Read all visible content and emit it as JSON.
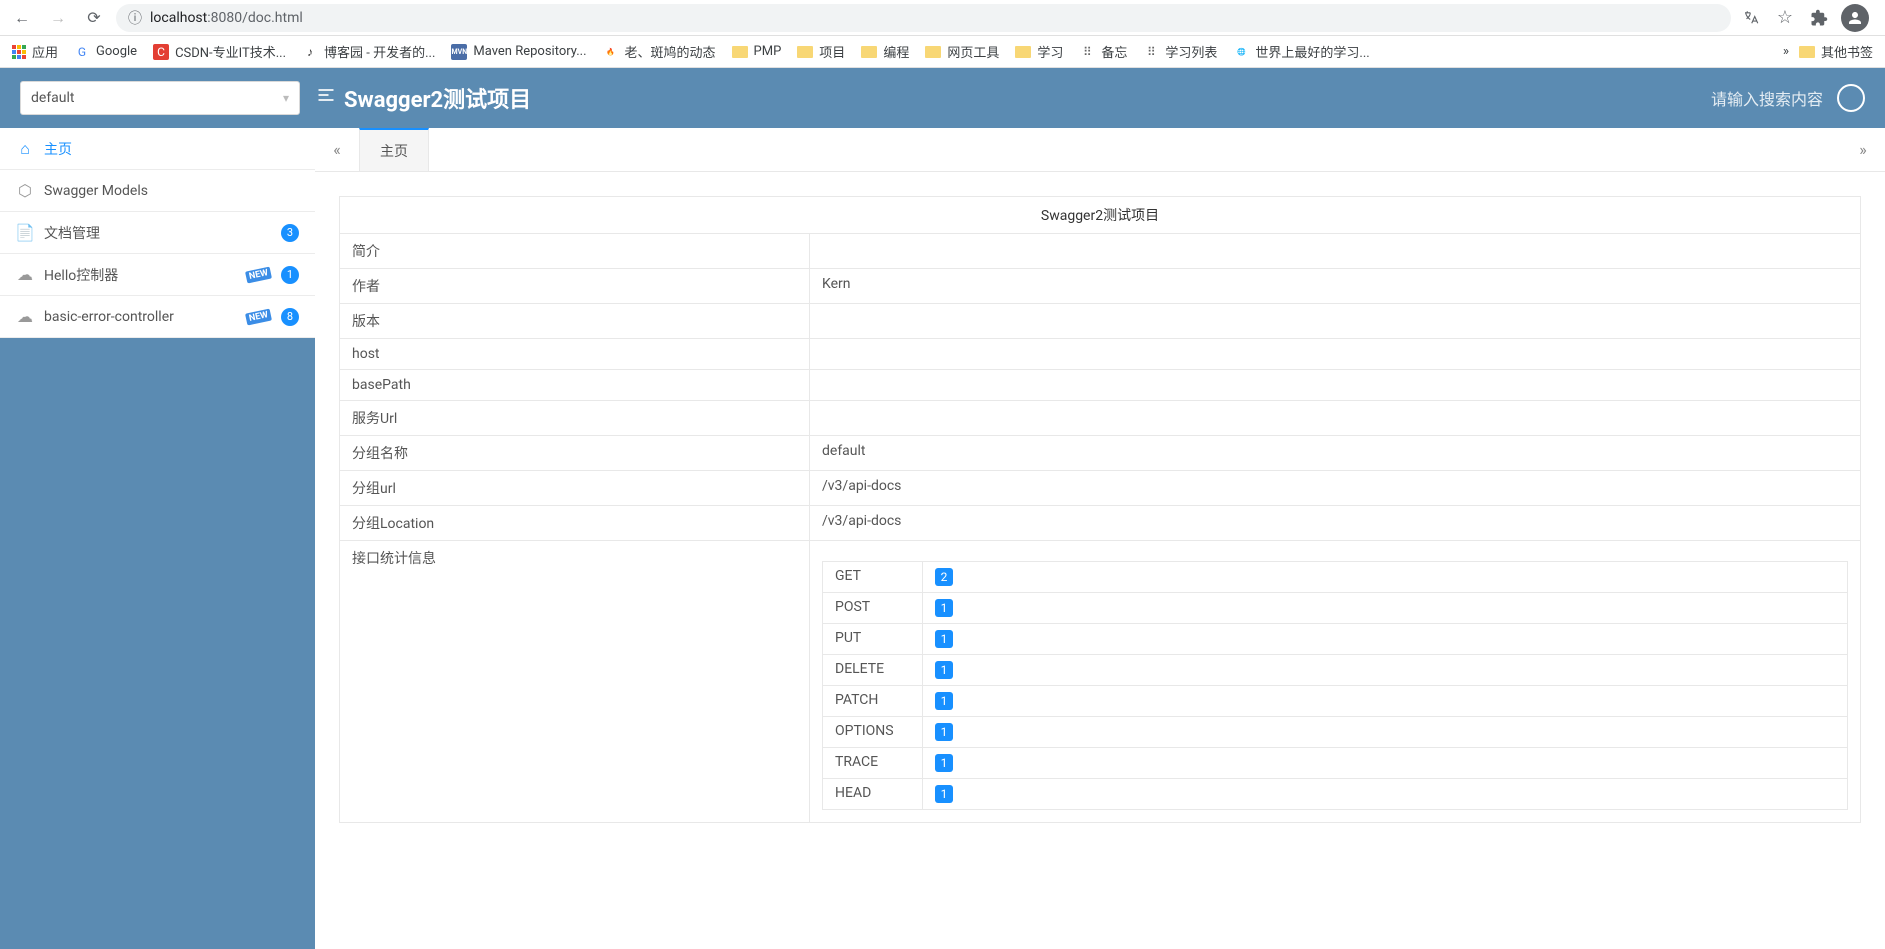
{
  "browser": {
    "url_security": "ⓘ",
    "url_host": "localhost",
    "url_port": ":8080",
    "url_path": "/doc.html"
  },
  "bookmarks": {
    "apps_label": "应用",
    "items": [
      {
        "label": "Google",
        "icon": "G",
        "color": "#4285f4"
      },
      {
        "label": "CSDN-专业IT技术...",
        "icon": "C",
        "color": "#e33e33",
        "bg": "#e33e33",
        "fg": "#fff"
      },
      {
        "label": "博客园 - 开发者的...",
        "icon": "♪",
        "color": "#333"
      },
      {
        "label": "Maven Repository...",
        "icon": "MVN",
        "color": "#fff",
        "bg": "#4a6da7"
      },
      {
        "label": "老、斑鸠的动态",
        "icon": "🔥",
        "color": "#f05654"
      },
      {
        "label": "PMP",
        "folder": true
      },
      {
        "label": "项目",
        "folder": true
      },
      {
        "label": "编程",
        "folder": true
      },
      {
        "label": "网页工具",
        "folder": true
      },
      {
        "label": "学习",
        "folder": true
      },
      {
        "label": "备忘",
        "icon": "⠿",
        "color": "#666"
      },
      {
        "label": "学习列表",
        "icon": "⠿",
        "color": "#666"
      },
      {
        "label": "世界上最好的学习...",
        "icon": "🌐",
        "color": "#666"
      }
    ],
    "overflow": "»",
    "other_label": "其他书签"
  },
  "header": {
    "select_value": "default",
    "title": "Swagger2测试项目",
    "search_placeholder": "请输入搜索内容"
  },
  "sidebar": {
    "items": [
      {
        "label": "主页",
        "icon": "⌂",
        "active": true
      },
      {
        "label": "Swagger Models",
        "icon": "⬡"
      },
      {
        "label": "文档管理",
        "icon": "📄",
        "count": "3"
      },
      {
        "label": "Hello控制器",
        "icon": "☁",
        "new": "NEW",
        "count": "1"
      },
      {
        "label": "basic-error-controller",
        "icon": "☁",
        "new": "NEW",
        "count": "8"
      }
    ]
  },
  "tabs": {
    "collapse_left": "«",
    "collapse_right": "»",
    "active_tab": "主页"
  },
  "info": {
    "title": "Swagger2测试项目",
    "rows": [
      {
        "label": "简介",
        "value": ""
      },
      {
        "label": "作者",
        "value": "Kern"
      },
      {
        "label": "版本",
        "value": ""
      },
      {
        "label": "host",
        "value": ""
      },
      {
        "label": "basePath",
        "value": ""
      },
      {
        "label": "服务Url",
        "value": ""
      },
      {
        "label": "分组名称",
        "value": "default"
      },
      {
        "label": "分组url",
        "value": "/v3/api-docs"
      },
      {
        "label": "分组Location",
        "value": "/v3/api-docs"
      }
    ],
    "stats_label": "接口统计信息",
    "stats": [
      {
        "method": "GET",
        "count": "2"
      },
      {
        "method": "POST",
        "count": "1"
      },
      {
        "method": "PUT",
        "count": "1"
      },
      {
        "method": "DELETE",
        "count": "1"
      },
      {
        "method": "PATCH",
        "count": "1"
      },
      {
        "method": "OPTIONS",
        "count": "1"
      },
      {
        "method": "TRACE",
        "count": "1"
      },
      {
        "method": "HEAD",
        "count": "1"
      }
    ]
  }
}
